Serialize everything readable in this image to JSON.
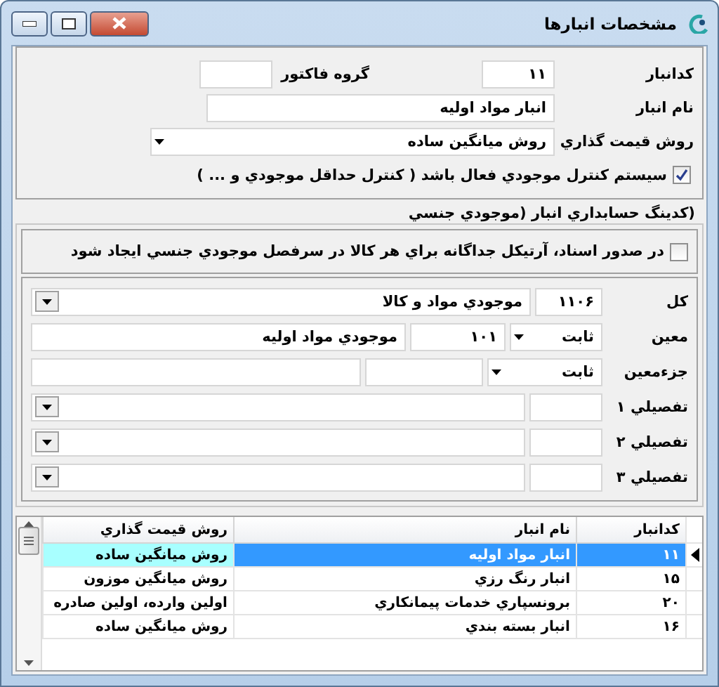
{
  "window": {
    "title": "مشخصات انبارها"
  },
  "general": {
    "code_label": "کدانبار",
    "code": "۱۱",
    "invoice_group_label": "گروه فاکتور",
    "name_label": "نام انبار",
    "name": "انبار مواد اولیه",
    "pricing_label": "روش قیمت گذاري",
    "pricing": "روش میانگین ساده",
    "stock_control": {
      "label": "سیستم کنترل موجودي فعال باشد ( کنترل حداقل موجودي و ... )",
      "checked": true
    }
  },
  "coding": {
    "title": "(کدینگ حسابداري انبار (موجودي جنسي",
    "separate_article": {
      "label": "در صدور اسناد، آرتیکل جداگانه براي هر کالا در سرفصل موجودي جنسي ایجاد شود",
      "checked": false
    },
    "rows": [
      {
        "kind": "ledger",
        "label": "کل",
        "code": "۱۱۰۶",
        "name": "موجودي مواد و کالا"
      },
      {
        "kind": "typed",
        "label": "معین",
        "type": "ثابت",
        "code": "۱۰۱",
        "name": "موجودي مواد اولیه"
      },
      {
        "kind": "typed",
        "label": "جزءمعین",
        "type": "ثابت",
        "code": "",
        "name": ""
      },
      {
        "kind": "ledger",
        "label": "تفصیلي ۱",
        "code": "",
        "name": ""
      },
      {
        "kind": "ledger",
        "label": "تفصیلي ۲",
        "code": "",
        "name": ""
      },
      {
        "kind": "ledger",
        "label": "تفصیلي ۳",
        "code": "",
        "name": ""
      }
    ]
  },
  "table": {
    "columns": [
      "کدانبار",
      "نام انبار",
      "روش قیمت گذاري"
    ],
    "rows": [
      {
        "code": "۱۱",
        "name": "انبار مواد اولیه",
        "method": "روش میانگین ساده",
        "selected": true
      },
      {
        "code": "۱۵",
        "name": "انبار رنگ رزي",
        "method": "روش میانگین موزون",
        "selected": false
      },
      {
        "code": "۲۰",
        "name": "برونسپاري خدمات پیمانکاري",
        "method": "اولین وارده، اولین صادره",
        "selected": false
      },
      {
        "code": "۱۶",
        "name": "انبار بسته بندي",
        "method": "روش میانگین ساده",
        "selected": false
      }
    ]
  }
}
